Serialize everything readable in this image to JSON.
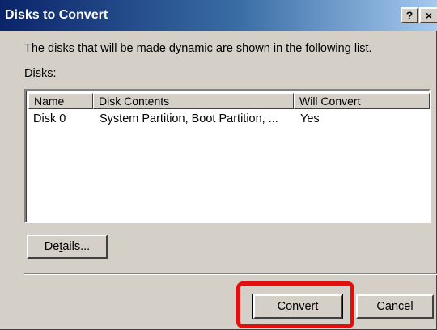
{
  "window": {
    "title": "Disks to Convert",
    "help_glyph": "?",
    "close_glyph": "×"
  },
  "description": "The disks that will be made dynamic are shown in the following list.",
  "disks_label": {
    "prefix": "D",
    "rest": "isks:"
  },
  "list": {
    "columns": [
      "Name",
      "Disk Contents",
      "Will Convert"
    ],
    "rows": [
      {
        "name": "Disk 0",
        "contents": "System Partition, Boot Partition, ...",
        "will_convert": "Yes"
      }
    ]
  },
  "buttons": {
    "details": {
      "prefix": "De",
      "accel": "t",
      "rest": "ails..."
    },
    "convert": {
      "accel": "C",
      "rest": "onvert"
    },
    "cancel": "Cancel"
  },
  "colors": {
    "title_bar": "#0a246a",
    "dialog_face": "#d4d0c8",
    "highlight": "#e01010"
  }
}
